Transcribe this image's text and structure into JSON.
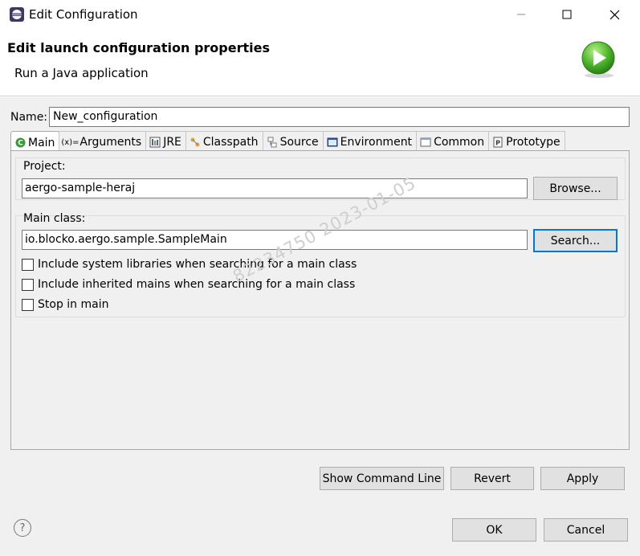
{
  "window": {
    "title": "Edit Configuration"
  },
  "header": {
    "title": "Edit launch configuration properties",
    "subtitle": "Run a Java application"
  },
  "name": {
    "label": "Name:",
    "value": "New_configuration"
  },
  "tabs": [
    {
      "label": "Main",
      "icon": "main-class-icon"
    },
    {
      "label": "Arguments",
      "icon": "arguments-icon"
    },
    {
      "label": "JRE",
      "icon": "jre-icon"
    },
    {
      "label": "Classpath",
      "icon": "classpath-icon"
    },
    {
      "label": "Source",
      "icon": "source-icon"
    },
    {
      "label": "Environment",
      "icon": "environment-icon"
    },
    {
      "label": "Common",
      "icon": "common-icon"
    },
    {
      "label": "Prototype",
      "icon": "prototype-icon"
    }
  ],
  "project": {
    "label": "Project:",
    "value": "aergo-sample-heraj",
    "button": "Browse..."
  },
  "main_class": {
    "label": "Main class:",
    "value": "io.blocko.aergo.sample.SampleMain",
    "button": "Search..."
  },
  "options": [
    {
      "label": "Include system libraries when searching for a main class",
      "checked": false
    },
    {
      "label": "Include inherited mains when searching for a main class",
      "checked": false
    },
    {
      "label": "Stop in main",
      "checked": false
    }
  ],
  "watermark": "82234750  2023-01-05",
  "actions": {
    "show_command_line": "Show Command Line",
    "revert": "Revert",
    "apply": "Apply"
  },
  "dialog": {
    "ok": "OK",
    "cancel": "Cancel",
    "help": "?"
  }
}
